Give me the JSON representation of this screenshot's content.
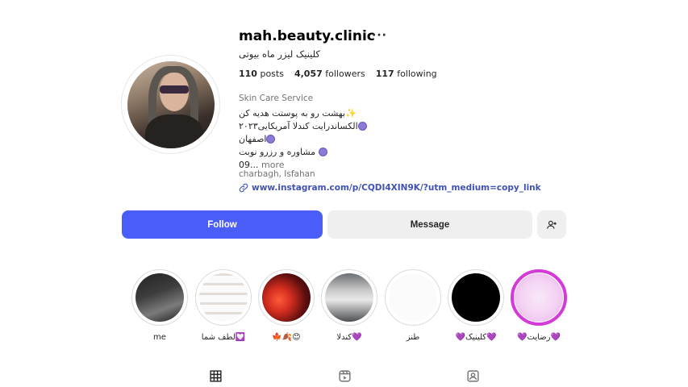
{
  "profile": {
    "username": "mah.beauty.clinic",
    "more_options": "···",
    "full_name": "کلینیک لیزر ماه بیوتی",
    "stats": {
      "posts_count": "110",
      "posts_label": "posts",
      "followers_count": "4,057",
      "followers_label": "followers",
      "following_count": "117",
      "following_label": "following"
    },
    "category": "Skin Care Service",
    "bio": {
      "line1": "بهشت رو به پوستت هدیه کن",
      "line2": "الکساندرایت کندلا آمریکایی۲۰۲۳",
      "line3": "اصفهان",
      "line4": "مشاوره و رزرو نوبت",
      "line5_prefix": "09...",
      "more_label": "more"
    },
    "location": "charbagh, Isfahan",
    "link": "www.instagram.com/p/CQDI4XIN9K/?utm_medium=copy_link"
  },
  "actions": {
    "follow_label": "Follow",
    "message_label": "Message"
  },
  "highlights": [
    {
      "label": "me"
    },
    {
      "label": "لطف شما💟"
    },
    {
      "label": "🍁🍂😊"
    },
    {
      "label": "کندلا💜"
    },
    {
      "label": "طنز"
    },
    {
      "label": "💜کلینیک💜"
    },
    {
      "label": "💜رضایت💜"
    }
  ],
  "tabs": [
    {
      "icon": "grid-icon"
    },
    {
      "icon": "reels-icon"
    },
    {
      "icon": "tagged-icon"
    }
  ],
  "colors": {
    "accent": "#4a5df9",
    "link": "#3f51b5",
    "highlight_ring": "#d43ad8",
    "bio_dot": "#8c7ad6"
  }
}
